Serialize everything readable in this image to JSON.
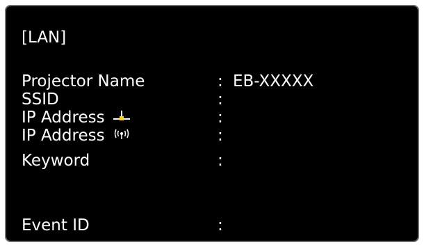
{
  "panel": {
    "title": "[LAN]",
    "rows": [
      {
        "label": "Projector Name",
        "colon": ":",
        "value": "EB-XXXXX",
        "icon": ""
      },
      {
        "label": "SSID",
        "colon": ":",
        "value": "",
        "icon": ""
      },
      {
        "label": "IP Address",
        "colon": ":",
        "value": "",
        "icon": "wired-lan-icon"
      },
      {
        "label": "IP Address",
        "colon": ":",
        "value": "",
        "icon": "wireless-lan-icon"
      },
      {
        "label": "Keyword",
        "colon": ":",
        "value": "",
        "icon": ""
      },
      {
        "label": "Event ID",
        "colon": ":",
        "value": "",
        "icon": ""
      }
    ]
  },
  "colors": {
    "background": "#000000",
    "text": "#ffffff",
    "border": "#6b6b6b",
    "wired_icon_accent": "#ffd400"
  }
}
